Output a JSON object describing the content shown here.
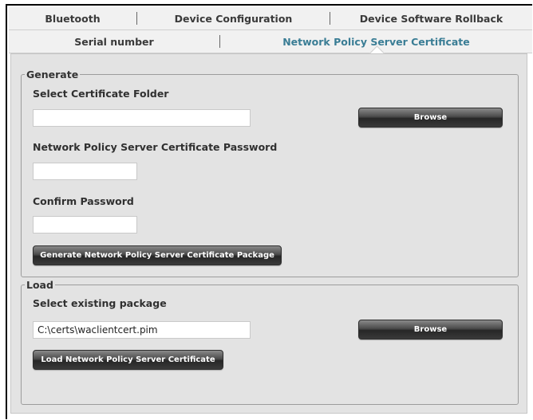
{
  "tabs_row1": [
    {
      "label": "Bluetooth"
    },
    {
      "label": "Device Configuration"
    },
    {
      "label": "Device Software Rollback"
    }
  ],
  "tabs_row2": [
    {
      "label": "Serial number"
    },
    {
      "label": "Network Policy Server Certificate",
      "active": true
    }
  ],
  "generate": {
    "legend": "Generate",
    "folder_label": "Select Certificate Folder",
    "folder_value": "",
    "browse_label": "Browse",
    "password_label": "Network Policy Server Certificate Password",
    "password_value": "",
    "confirm_label": "Confirm Password",
    "confirm_value": "",
    "generate_button_label": "Generate Network Policy Server Certificate Package"
  },
  "load": {
    "legend": "Load",
    "package_label": "Select existing package",
    "package_value": "C:\\certs\\waclientcert.pim",
    "browse_label": "Browse",
    "load_button_label": "Load Network Policy Server Certificate"
  },
  "colors": {
    "active_tab": "#3a7d95",
    "panel_bg": "#e3e3e3",
    "button_dark": "#2a2a2a"
  }
}
